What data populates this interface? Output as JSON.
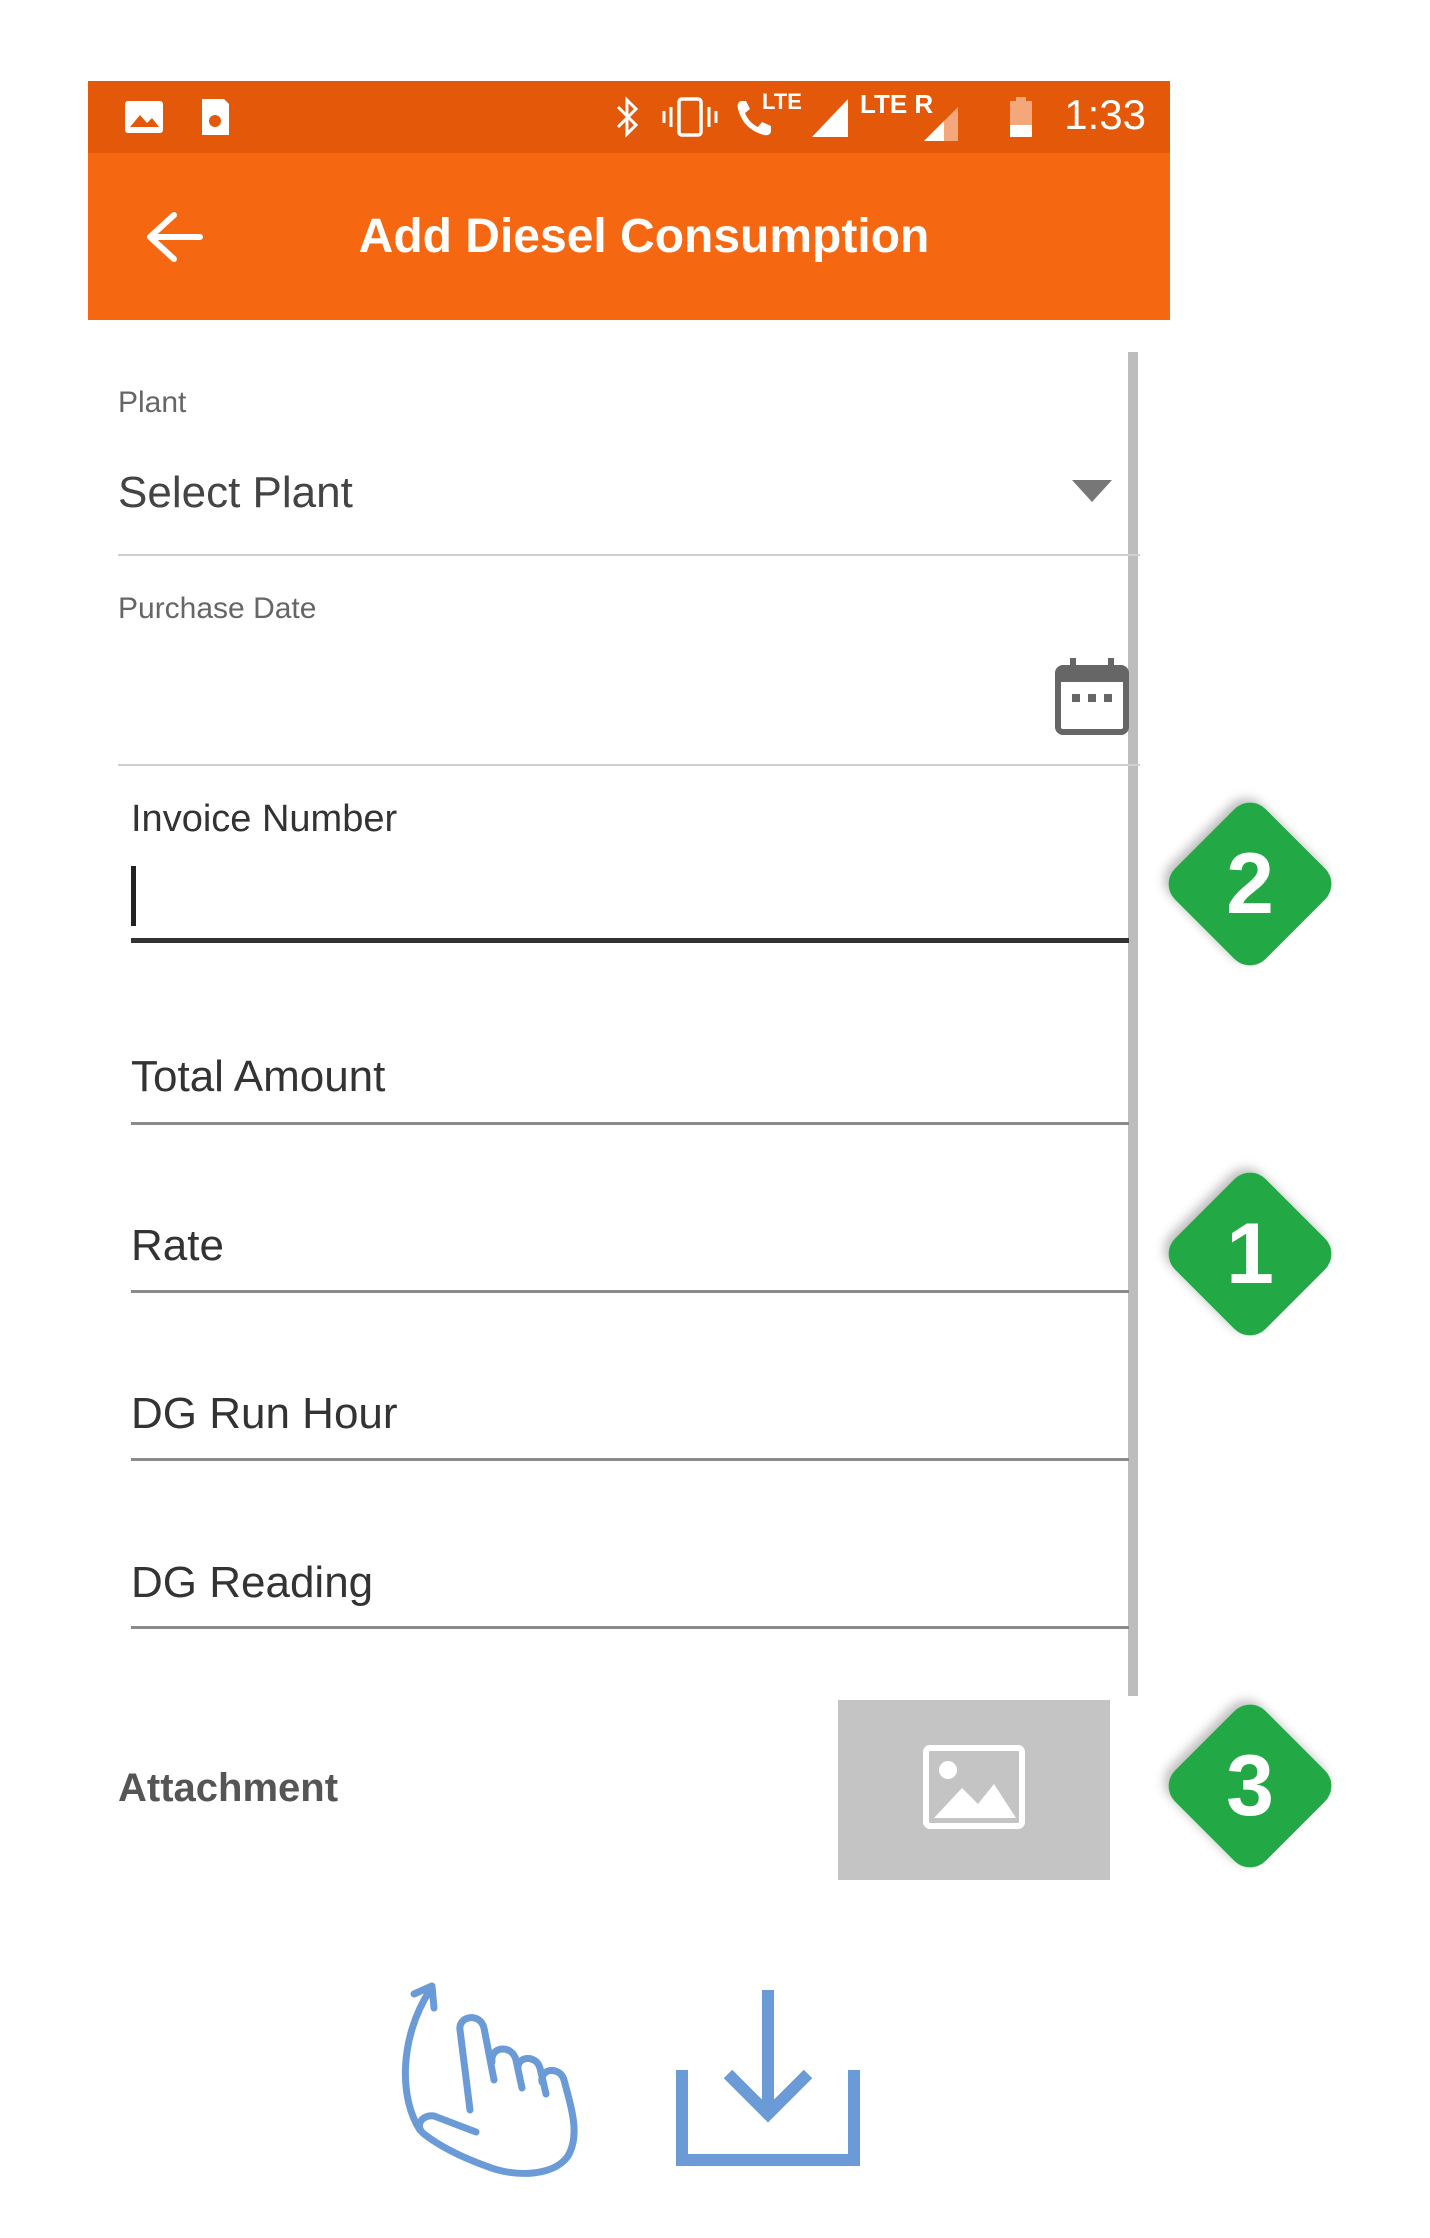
{
  "status_bar": {
    "time": "1:33",
    "icons": [
      "image-icon",
      "sim-icon",
      "bluetooth-icon",
      "vibrate-icon",
      "volte-call-icon",
      "signal-icon",
      "lte-roaming-icon",
      "battery-icon"
    ],
    "lte_label": "LTE",
    "lte_roaming_label": "LTE R",
    "color": "#e35809"
  },
  "app_bar": {
    "title": "Add Diesel Consumption",
    "back_icon": "arrow-left-icon",
    "color": "#f66712"
  },
  "form": {
    "plant": {
      "label": "Plant",
      "value": "Select Plant"
    },
    "purchase_date": {
      "label": "Purchase Date",
      "value": ""
    },
    "invoice_number": {
      "label": "Invoice Number",
      "value": ""
    },
    "total_amount": {
      "placeholder": "Total Amount"
    },
    "rate": {
      "placeholder": "Rate"
    },
    "dg_run_hour": {
      "placeholder": "DG Run Hour"
    },
    "dg_reading": {
      "placeholder": "DG Reading"
    },
    "attachment": {
      "label": "Attachment"
    }
  },
  "badges": [
    {
      "number": "2",
      "color": "#22a845"
    },
    {
      "number": "1",
      "color": "#22a845"
    },
    {
      "number": "3",
      "color": "#22a845"
    }
  ],
  "footer_icons": [
    "tap-gesture-icon",
    "download-icon"
  ],
  "icon_color": "#6a9bd6"
}
